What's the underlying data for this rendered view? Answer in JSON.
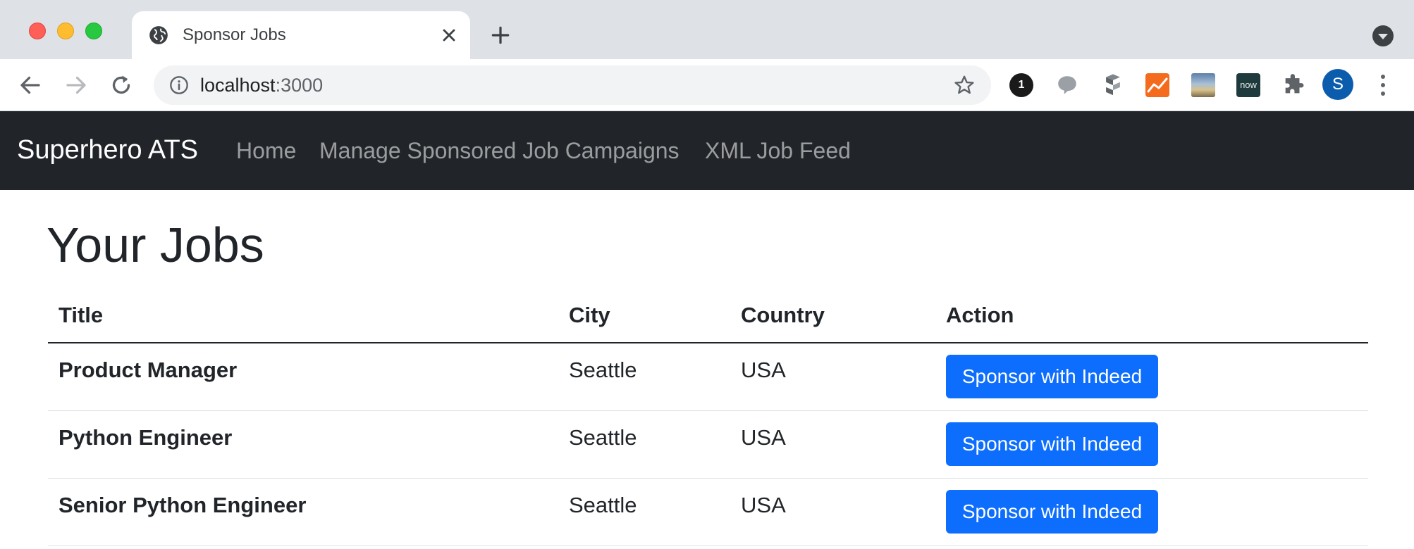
{
  "browser": {
    "tab_title": "Sponsor Jobs",
    "url_host": "localhost",
    "url_port": ":3000",
    "extension_1p_label": "1",
    "extension_now_label": "now",
    "profile_initial": "S"
  },
  "navbar": {
    "brand": "Superhero ATS",
    "links": [
      "Home",
      "Manage Sponsored Job Campaigns",
      "XML Job Feed"
    ]
  },
  "main": {
    "heading": "Your Jobs",
    "columns": [
      "Title",
      "City",
      "Country",
      "Action"
    ],
    "rows": [
      {
        "title": "Product Manager",
        "city": "Seattle",
        "country": "USA",
        "action": "Sponsor with Indeed"
      },
      {
        "title": "Python Engineer",
        "city": "Seattle",
        "country": "USA",
        "action": "Sponsor with Indeed"
      },
      {
        "title": "Senior Python Engineer",
        "city": "Seattle",
        "country": "USA",
        "action": "Sponsor with Indeed"
      }
    ]
  },
  "colors": {
    "navbar_bg": "#212529",
    "primary_button": "#0d6efd",
    "chrome_bg": "#dee1e6"
  },
  "icons": [
    "globe-icon",
    "close-icon",
    "plus-icon",
    "back-icon",
    "forward-icon",
    "reload-icon",
    "info-icon",
    "star-icon",
    "puzzle-icon",
    "kebab-menu-icon"
  ]
}
